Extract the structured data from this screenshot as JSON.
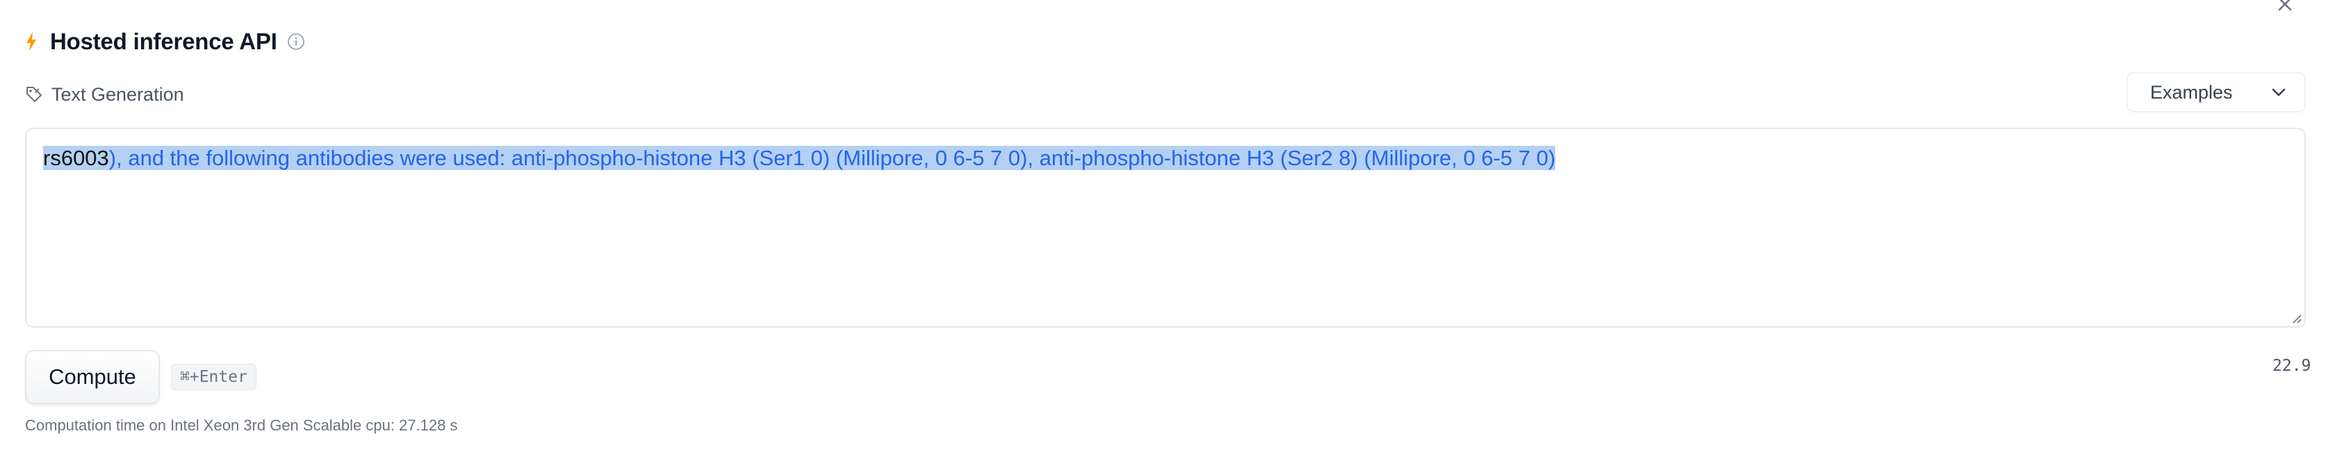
{
  "widget": {
    "title": "Hosted inference API",
    "task": "Text Generation",
    "examples_label": "Examples"
  },
  "input": {
    "segments": [
      {
        "text": "rs6003",
        "style": "selected-dark"
      },
      {
        "text": "), and the following antibodies were used: anti-phospho-histone H3 (Ser1 0) (Millipore, 0 6-5 7 0), anti-phospho-histone H3 (Ser2 8) (Millipore, 0 6-5 7 0)",
        "style": "selected-blue"
      }
    ]
  },
  "actions": {
    "compute_label": "Compute",
    "shortcut": "⌘+Enter",
    "value": "22.9"
  },
  "footer": {
    "computation_time": "Computation time on Intel Xeon 3rd Gen Scalable cpu: 27.128 s"
  },
  "icons": {
    "bolt": "bolt-icon",
    "info": "info-icon",
    "task": "tag-icon",
    "dropdown": "chevron-down-icon",
    "close": "close-icon"
  },
  "colors": {
    "accent": "#f59e0b",
    "selection": "#b4d0f3",
    "generated_text": "#2563eb"
  }
}
